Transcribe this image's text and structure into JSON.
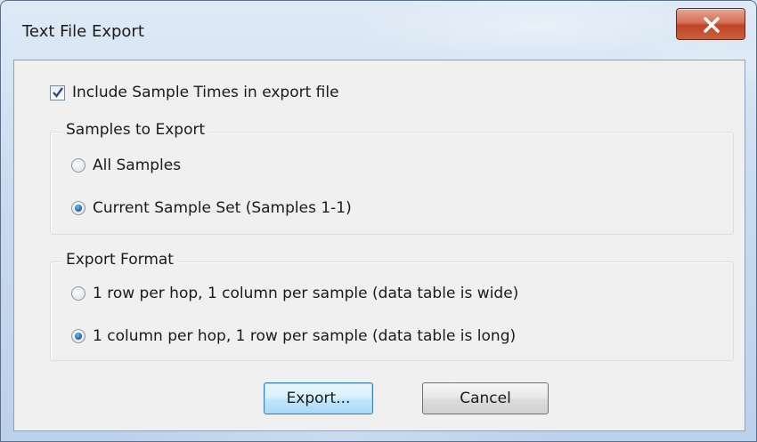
{
  "window": {
    "title": "Text File Export"
  },
  "options": {
    "include_times_label": "Include Sample Times in export file",
    "include_times_checked": true
  },
  "samples_group": {
    "legend": "Samples to Export",
    "all_label": "All Samples",
    "current_label": "Current Sample Set (Samples 1-1)",
    "selected": "current"
  },
  "format_group": {
    "legend": "Export Format",
    "wide_label": "1 row per hop, 1 column per sample (data table is wide)",
    "long_label": "1 column per hop, 1 row per sample (data table is long)",
    "selected": "long"
  },
  "buttons": {
    "export_label": "Export...",
    "cancel_label": "Cancel"
  },
  "colors": {
    "close_button": "#c9623d",
    "default_button_border": "#3c7fb1",
    "radio_selected": "#1c5aa8"
  }
}
